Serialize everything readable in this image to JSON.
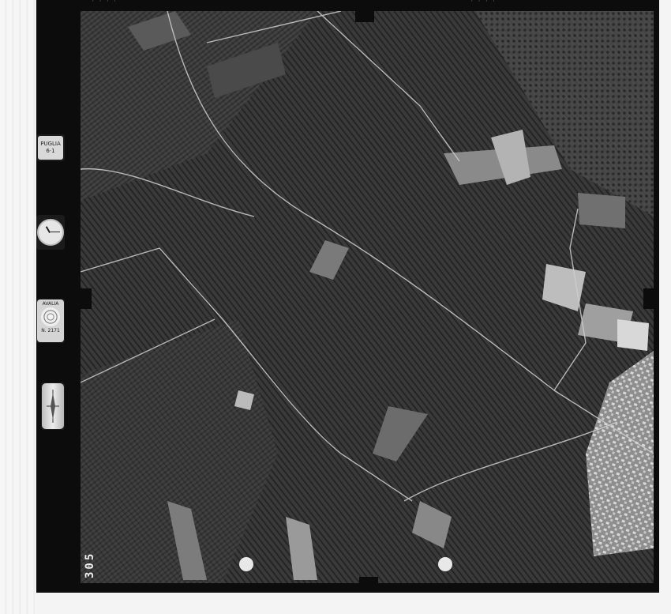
{
  "image": {
    "type": "aerial photograph (black and white)",
    "frame_number": "305",
    "top_codes": [
      "· · · ·",
      "· · · ·"
    ],
    "instruments": {
      "level": {
        "label": "PUGLIA",
        "value": "6·1"
      },
      "clock": {
        "icon": "clock-icon",
        "time": "10:15"
      },
      "altimeter": {
        "label": "AVALIA",
        "serial": "N. 2171"
      },
      "compass": {
        "icon": "compass-icon"
      }
    }
  }
}
